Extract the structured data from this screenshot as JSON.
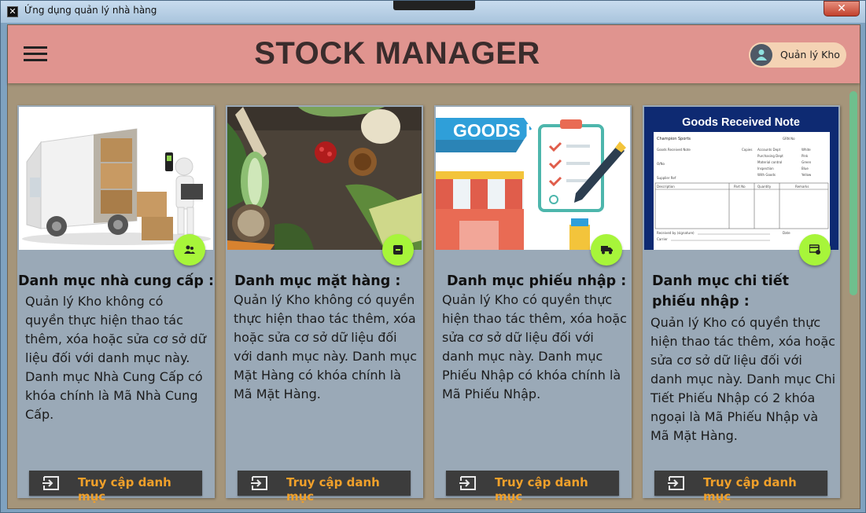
{
  "window": {
    "title": "Ứng dụng quản lý nhà hàng",
    "close_glyph": "✕"
  },
  "header": {
    "title": "STOCK MANAGER",
    "user_role": "Quản lý Kho"
  },
  "cards": [
    {
      "title": "Danh mục nhà cung cấp :",
      "description": "Quản lý Kho không có quyền thực hiện thao tác thêm, xóa hoặc sửa cơ sở dữ liệu đối với danh mục này. Danh mục Nhà Cung Cấp có khóa chính là Mã Nhà Cung Cấp.",
      "button_label": "Truy cập danh mục",
      "icon": "supplier-icon"
    },
    {
      "title": "Danh mục mặt hàng :",
      "description": "Quản lý Kho không có quyền thực hiện thao tác thêm, xóa hoặc sửa cơ sở dữ liệu đối với danh mục này. Danh mục Mặt Hàng có khóa chính là Mã Mặt Hàng.",
      "button_label": "Truy cập danh mục",
      "icon": "inventory-icon"
    },
    {
      "title": "Danh mục phiếu nhập :",
      "description": "Quản lý Kho có quyền thực hiện thao tác thêm, xóa hoặc sửa cơ sở dữ liệu đối với danh mục này. Danh mục Phiếu Nhập có khóa chính là Mã Phiếu Nhập.",
      "button_label": "Truy cập danh mục",
      "icon": "truck-icon"
    },
    {
      "title": "Danh mục chi tiết phiếu nhập :",
      "description": "Quản lý Kho có quyền thực hiện thao tác thêm, xóa hoặc sửa cơ sở dữ liệu đối với danh mục này. Danh mục Chi Tiết Phiếu Nhập có 2 khóa ngoại là Mã Phiếu Nhập và Mã Mặt Hàng.",
      "button_label": "Truy cập danh mục",
      "icon": "receipt-icon"
    }
  ],
  "images": {
    "goods_receipt_banner": "GOODS RECEIPT",
    "goods_received_note": {
      "title": "Goods Received Note",
      "company": "Champion Sports",
      "grn_no": "GRN No",
      "row_labels": [
        "Goods Received Note",
        "O/No",
        "Supplier Ref"
      ],
      "copies": [
        "Copies",
        "Accounts Dept",
        "Purchasing Dept",
        "Material control",
        "Inspection",
        "With Goods"
      ],
      "copy_colors": [
        "White",
        "Pink",
        "Green",
        "Blue",
        "Yellow"
      ],
      "columns": [
        "Description",
        "Part No",
        "Quantity",
        "Remarks"
      ],
      "footer": [
        "Received by (signature)",
        "Carrier",
        "Date"
      ]
    }
  },
  "colors": {
    "header_bg": "#e0948f",
    "card_bg": "#9aa9b7",
    "fab": "#a7f53a",
    "button_text": "#f0a02a",
    "client_bg": "#a5957a"
  }
}
